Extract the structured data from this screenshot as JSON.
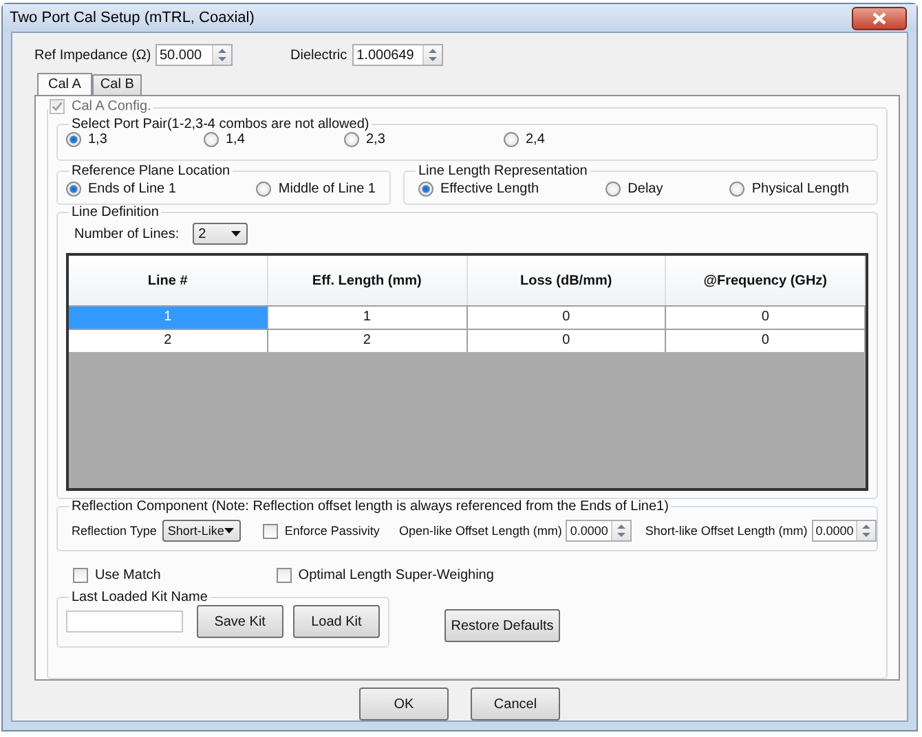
{
  "window": {
    "title": "Two Port Cal Setup (mTRL, Coaxial)"
  },
  "fields": [
    {
      "label": "Ref Impedance (Ω)",
      "value": "50.000"
    },
    {
      "label": "Dielectric",
      "value": "1.000649"
    }
  ],
  "tabs": [
    {
      "label": "Cal A",
      "selected": true
    },
    {
      "label": "Cal B",
      "selected": false
    }
  ],
  "config": {
    "label": "Cal A Config.",
    "checked": true,
    "disabled": true
  },
  "port_pair": {
    "title": "Select Port Pair(1-2,3-4 combos are not allowed)",
    "options": [
      {
        "label": "1,3",
        "selected": true
      },
      {
        "label": "1,4",
        "selected": false
      },
      {
        "label": "2,3",
        "selected": false
      },
      {
        "label": "2,4",
        "selected": false
      }
    ]
  },
  "reference_plane": {
    "title": "Reference Plane Location",
    "options": [
      {
        "label": "Ends of Line 1",
        "selected": true
      },
      {
        "label": "Middle of Line 1",
        "selected": false
      }
    ]
  },
  "line_length": {
    "title": "Line Length Representation",
    "options": [
      {
        "label": "Effective Length",
        "selected": true
      },
      {
        "label": "Delay",
        "selected": false
      },
      {
        "label": "Physical Length",
        "selected": false
      }
    ]
  },
  "line_definition": {
    "title": "Line Definition",
    "count_label": "Number of Lines:",
    "count": "2",
    "table": {
      "columns": [
        "Line #",
        "Eff. Length (mm)",
        "Loss (dB/mm)",
        "@Frequency (GHz)"
      ],
      "rows": [
        {
          "cells": [
            "1",
            "1",
            "0",
            "0"
          ],
          "selected": true
        },
        {
          "cells": [
            "2",
            "2",
            "0",
            "0"
          ],
          "selected": false
        }
      ]
    }
  },
  "reflection": {
    "title": "Reflection Component (Note: Reflection offset length is always referenced from the Ends of Line1)",
    "type_label": "Reflection Type",
    "type": "Short-Like",
    "passivity": {
      "label": "Enforce Passivity",
      "checked": false
    },
    "offsets": [
      {
        "label": "Open-like Offset Length (mm)",
        "value": "0.0000"
      },
      {
        "label": "Short-like Offset Length (mm)",
        "value": "0.0000"
      }
    ]
  },
  "options": [
    {
      "label": "Use Match",
      "checked": false
    },
    {
      "label": "Optimal Length Super-Weighing",
      "checked": false
    }
  ],
  "kit": {
    "title": "Last Loaded Kit Name",
    "buttons": [
      "Save Kit",
      "Load Kit"
    ]
  },
  "restore_button": "Restore Defaults",
  "buttons": [
    "OK",
    "Cancel"
  ]
}
